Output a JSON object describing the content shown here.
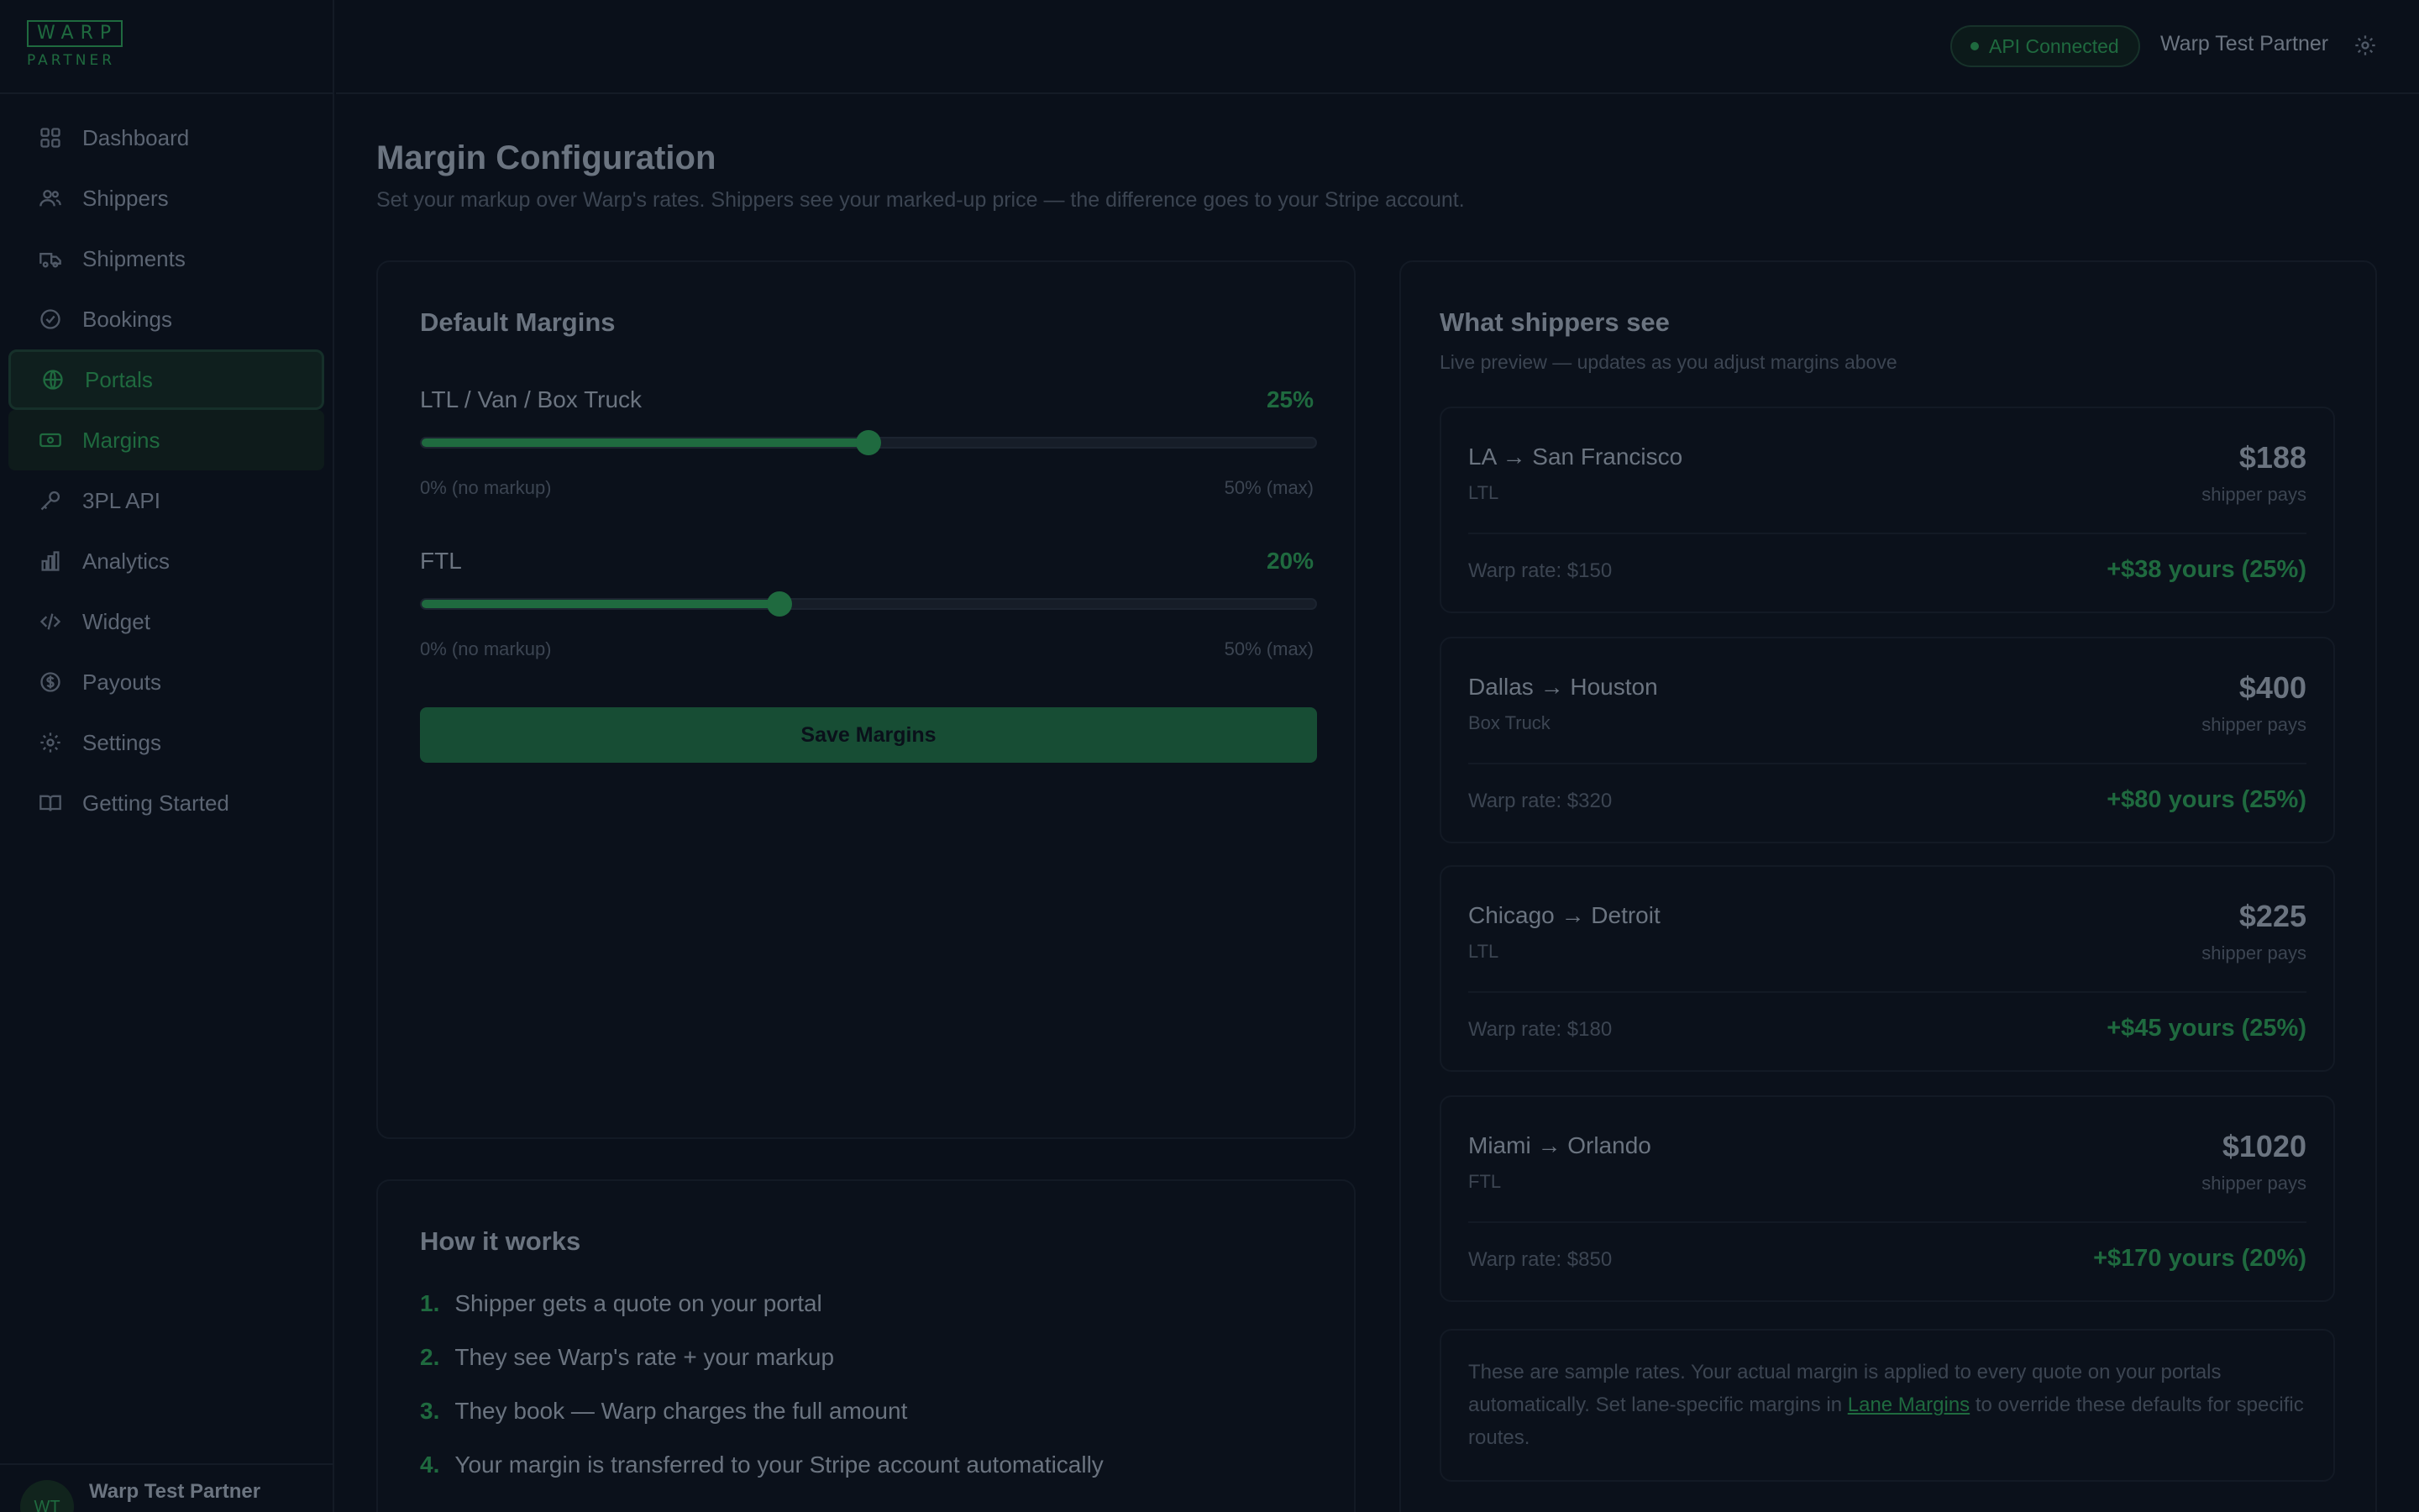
{
  "brand": {
    "logo": "WARP",
    "sub": "PARTNER"
  },
  "sidebar": {
    "items": [
      {
        "label": "Dashboard",
        "icon": "grid-icon"
      },
      {
        "label": "Shippers",
        "icon": "users-icon"
      },
      {
        "label": "Shipments",
        "icon": "truck-icon"
      },
      {
        "label": "Bookings",
        "icon": "check-circle-icon"
      },
      {
        "label": "Portals",
        "icon": "globe-icon"
      },
      {
        "label": "Margins",
        "icon": "banknote-icon"
      },
      {
        "label": "3PL API",
        "icon": "key-icon"
      },
      {
        "label": "Analytics",
        "icon": "bar-chart-icon"
      },
      {
        "label": "Widget",
        "icon": "code-icon"
      },
      {
        "label": "Payouts",
        "icon": "dollar-circle-icon"
      },
      {
        "label": "Settings",
        "icon": "gear-icon"
      },
      {
        "label": "Getting Started",
        "icon": "book-icon"
      }
    ],
    "user": {
      "initials": "WT",
      "name": "Warp Test Partner"
    }
  },
  "topbar": {
    "status": "API Connected",
    "partner": "Warp Test Partner"
  },
  "page": {
    "title": "Margin Configuration",
    "subtitle": "Set your markup over Warp's rates. Shippers see your marked-up price — the difference goes to your Stripe account."
  },
  "defaults": {
    "title": "Default Margins",
    "sliders": [
      {
        "label": "LTL / Van / Box Truck",
        "value_text": "25%",
        "value": 25,
        "max": 50,
        "min_text": "0% (no markup)",
        "max_text": "50% (max)"
      },
      {
        "label": "FTL",
        "value_text": "20%",
        "value": 20,
        "max": 50,
        "min_text": "0% (no markup)",
        "max_text": "50% (max)"
      }
    ],
    "save_label": "Save Margins"
  },
  "how": {
    "title": "How it works",
    "steps": [
      {
        "num": "1.",
        "text": "Shipper gets a quote on your portal"
      },
      {
        "num": "2.",
        "text": "They see Warp's rate + your markup"
      },
      {
        "num": "3.",
        "text": "They book — Warp charges the full amount"
      },
      {
        "num": "4.",
        "text": "Your margin is transferred to your Stripe account automatically"
      }
    ]
  },
  "preview": {
    "title": "What shippers see",
    "subtitle": "Live preview — updates as you adjust margins above",
    "lanes": [
      {
        "route": "LA → San Francisco",
        "mode": "LTL",
        "price": "$188",
        "pays": "shipper pays",
        "warp": "Warp rate: $150",
        "yours": "+$38 yours (25%)"
      },
      {
        "route": "Dallas → Houston",
        "mode": "Box Truck",
        "price": "$400",
        "pays": "shipper pays",
        "warp": "Warp rate: $320",
        "yours": "+$80 yours (25%)"
      },
      {
        "route": "Chicago → Detroit",
        "mode": "LTL",
        "price": "$225",
        "pays": "shipper pays",
        "warp": "Warp rate: $180",
        "yours": "+$45 yours (25%)"
      },
      {
        "route": "Miami → Orlando",
        "mode": "FTL",
        "price": "$1020",
        "pays": "shipper pays",
        "warp": "Warp rate: $850",
        "yours": "+$170 yours (20%)"
      }
    ],
    "note_before": "These are sample rates. Your actual margin is applied to every quote on your portals automatically. Set lane-specific margins in ",
    "note_link": "Lane Margins",
    "note_after": " to override these defaults for specific routes."
  },
  "colors": {
    "accent": "#1f6a3f",
    "background": "#0a101a"
  }
}
